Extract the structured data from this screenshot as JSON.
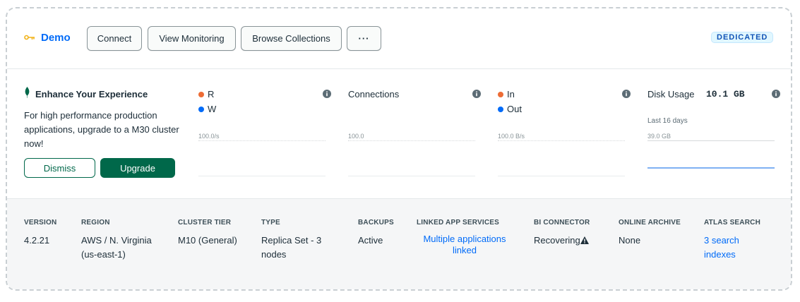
{
  "header": {
    "cluster_name": "Demo",
    "buttons": {
      "connect": "Connect",
      "view_monitoring": "View Monitoring",
      "browse_collections": "Browse Collections",
      "more": "···"
    },
    "badge": "DEDICATED",
    "icons": {
      "cluster": "key-icon",
      "more": "ellipsis-icon"
    }
  },
  "promo": {
    "title": "Enhance Your Experience",
    "text": "For high performance production applications, upgrade to a M30 cluster now!",
    "dismiss_label": "Dismiss",
    "upgrade_label": "Upgrade",
    "icon": "leaf-icon"
  },
  "metrics": {
    "rw": {
      "legend": [
        "R",
        "W"
      ],
      "colors": [
        "#ed6c35",
        "#016bf8"
      ],
      "max": "100.0/s"
    },
    "connections": {
      "title": "Connections",
      "max": "100.0"
    },
    "network": {
      "legend": [
        "In",
        "Out"
      ],
      "colors": [
        "#ed6c35",
        "#016bf8"
      ],
      "max": "100.0 B/s"
    },
    "disk": {
      "title": "Disk Usage",
      "value": "10.1 GB",
      "period": "Last 16 days",
      "max": "39.0 GB"
    }
  },
  "details": {
    "version": {
      "label": "VERSION",
      "value": "4.2.21"
    },
    "region": {
      "label": "REGION",
      "value": "AWS / N. Virginia (us-east-1)"
    },
    "tier": {
      "label": "CLUSTER TIER",
      "value": "M10 (General)"
    },
    "type": {
      "label": "TYPE",
      "value": "Replica Set - 3 nodes"
    },
    "backups": {
      "label": "BACKUPS",
      "value": "Active"
    },
    "app_services": {
      "label": "LINKED APP SERVICES",
      "value": "Multiple applications linked"
    },
    "bi_connector": {
      "label": "BI CONNECTOR",
      "value": "Recovering",
      "icon": "warning-icon"
    },
    "archive": {
      "label": "ONLINE ARCHIVE",
      "value": "None"
    },
    "search": {
      "label": "ATLAS SEARCH",
      "value": "3 search indexes"
    }
  },
  "colors": {
    "link": "#016bf8",
    "brand_green": "#00684a",
    "badge_bg": "#e1f7ff"
  }
}
